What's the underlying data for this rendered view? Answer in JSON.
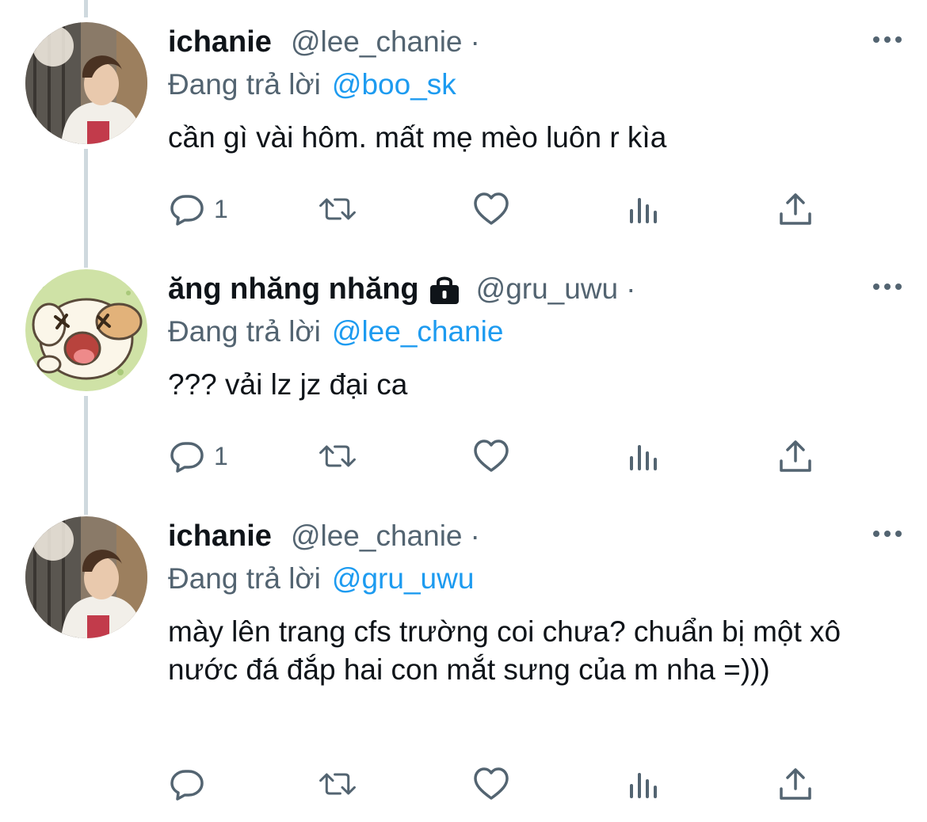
{
  "tweets": [
    {
      "display_name": "ichanie",
      "handle": "@lee_chanie",
      "separator": "·",
      "reply_prefix": "Đang trả lời",
      "reply_to": "@boo_sk",
      "text": "cần gì vài hôm. mất mẹ mèo luôn r kìa",
      "reply_count": "1",
      "locked": false
    },
    {
      "display_name": "ăng nhăng nhăng",
      "handle": "@gru_uwu",
      "separator": "·",
      "reply_prefix": "Đang trả lời",
      "reply_to": "@lee_chanie",
      "text": "??? vải lz jz đại ca",
      "reply_count": "1",
      "locked": true
    },
    {
      "display_name": "ichanie",
      "handle": "@lee_chanie",
      "separator": "·",
      "reply_prefix": "Đang trả lời",
      "reply_to": "@gru_uwu",
      "text": "mày lên trang cfs trường coi chưa? chuẩn bị một xô nước đá đắp hai con mắt sưng của m nha =)))",
      "reply_count": "",
      "locked": false
    }
  ],
  "colors": {
    "text": "#0f1419",
    "secondary": "#536471",
    "link": "#1d9bf0",
    "thread_line": "#cfd9de"
  },
  "icons": {
    "reply": "speech-bubble-icon",
    "retweet": "retweet-icon",
    "like": "heart-icon",
    "views": "bar-chart-icon",
    "share": "share-upload-icon",
    "more": "more-dots-icon",
    "lock": "lock-icon"
  }
}
